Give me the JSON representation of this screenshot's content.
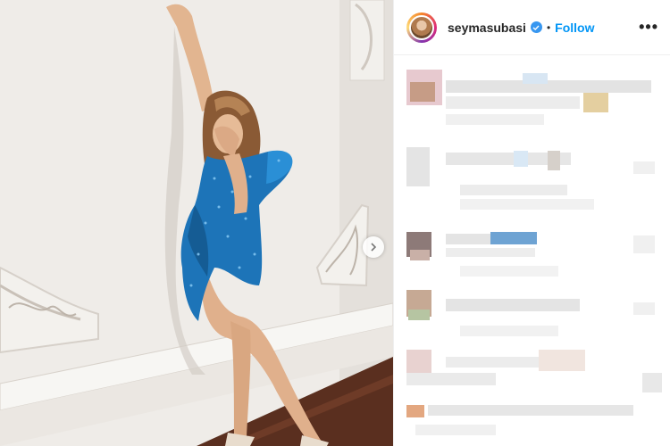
{
  "post": {
    "username": "seymasubasi",
    "separator": "•",
    "follow_label": "Follow",
    "more_label": "•••"
  },
  "colors": {
    "follow_blue": "#0095f6",
    "verified_blue": "#3897f0",
    "dress_blue": "#1d74b8"
  },
  "icons": {
    "verified": "verified-badge-icon",
    "next": "chevron-right-icon",
    "more": "more-options-icon"
  }
}
